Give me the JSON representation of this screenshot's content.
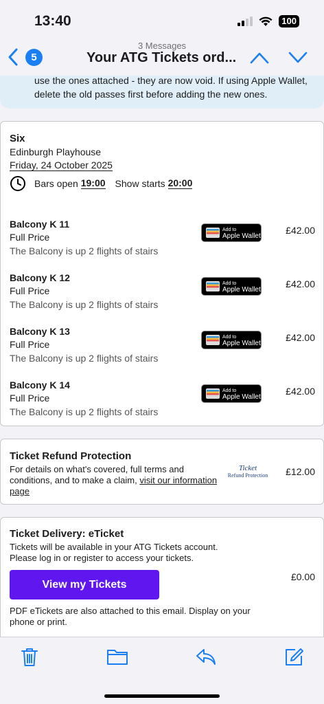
{
  "status": {
    "time": "13:40",
    "battery": "100"
  },
  "nav": {
    "unread_count": "5",
    "subtitle": "3 Messages",
    "title": "Your ATG Tickets ord..."
  },
  "banner": {
    "line1": "use the ones attached - they are now void. If using Apple Wallet,",
    "line2": "delete the old passes first before adding the new ones."
  },
  "show": {
    "title": "Six",
    "venue": "Edinburgh Playhouse",
    "date": "Friday, 24 October 2025",
    "bars_label": "Bars open",
    "bars_time": "19:00",
    "show_label": "Show starts",
    "show_time": "20:00"
  },
  "seats": [
    {
      "name": "Balcony K 11",
      "type": "Full Price",
      "note": "The Balcony is up 2 flights of stairs",
      "price": "£42.00"
    },
    {
      "name": "Balcony K 12",
      "type": "Full Price",
      "note": "The Balcony is up 2 flights of stairs",
      "price": "£42.00"
    },
    {
      "name": "Balcony K 13",
      "type": "Full Price",
      "note": "The Balcony is up 2 flights of stairs",
      "price": "£42.00"
    },
    {
      "name": "Balcony K 14",
      "type": "Full Price",
      "note": "The Balcony is up 2 flights of stairs",
      "price": "£42.00"
    }
  ],
  "wallet": {
    "small": "Add to",
    "big": "Apple Wallet"
  },
  "refund": {
    "title": "Ticket Refund Protection",
    "text": "For details on what's covered, full terms and conditions, and to make a claim,",
    "link": "visit our information page",
    "logo_line1": "Ticket",
    "logo_line2": "Refund Protection",
    "price": "£12.00"
  },
  "delivery": {
    "title": "Ticket Delivery: eTicket",
    "line1": "Tickets will be available in your ATG Tickets account.",
    "line2": "Please log in or register to access your tickets.",
    "button": "View my Tickets",
    "price": "£0.00",
    "note": "PDF eTickets are also attached to this email. Display on your phone or print."
  },
  "colors": {
    "accent": "#1a7ef5",
    "button": "#6016ee",
    "banner": "#e0eef7"
  },
  "toolbar": {
    "icons": [
      "trash-icon",
      "folder-icon",
      "reply-icon",
      "compose-icon"
    ]
  }
}
